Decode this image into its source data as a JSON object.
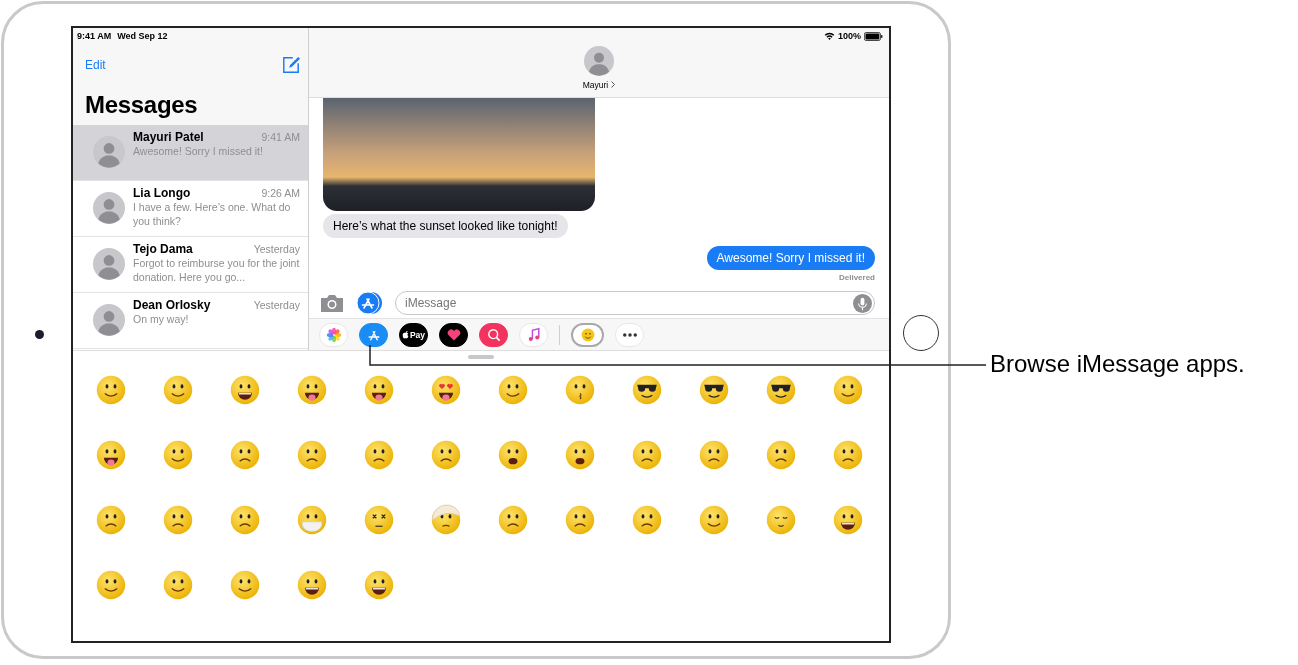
{
  "status_bar": {
    "time": "9:41 AM",
    "date": "Wed Sep 12",
    "battery": "100%"
  },
  "sidebar": {
    "edit": "Edit",
    "title": "Messages",
    "conversations": [
      {
        "name": "Mayuri Patel",
        "time": "9:41 AM",
        "preview": "Awesome! Sorry I missed it!",
        "selected": true
      },
      {
        "name": "Lia Longo",
        "time": "9:26 AM",
        "preview": "I have a few. Here’s one. What do you think?",
        "selected": false
      },
      {
        "name": "Tejo Dama",
        "time": "Yesterday",
        "preview": "Forgot to reimburse you for the joint donation. Here you go...",
        "selected": false
      },
      {
        "name": "Dean Orlosky",
        "time": "Yesterday",
        "preview": "On my way!",
        "selected": false
      }
    ]
  },
  "conversation": {
    "contact": "Mayuri",
    "messages": [
      {
        "kind": "photo",
        "incoming": true
      },
      {
        "kind": "text",
        "incoming": true,
        "text": "Here’s what the sunset looked like tonight!"
      },
      {
        "kind": "text",
        "incoming": false,
        "text": "Awesome! Sorry I missed it!"
      }
    ],
    "receipt": "Delivered",
    "input": {
      "placeholder": "iMessage"
    },
    "apps": [
      {
        "kind": "photos",
        "selected": false
      },
      {
        "kind": "store",
        "selected": false
      },
      {
        "kind": "pay",
        "label": "Pay",
        "selected": false
      },
      {
        "kind": "touch",
        "selected": false
      },
      {
        "kind": "images",
        "selected": false
      },
      {
        "kind": "music",
        "selected": false
      },
      {
        "kind": "stickers",
        "selected": true
      },
      {
        "kind": "more",
        "selected": false
      }
    ]
  },
  "stickers": [
    {
      "kind": "smile"
    },
    {
      "kind": "smile"
    },
    {
      "kind": "grin"
    },
    {
      "kind": "tongue"
    },
    {
      "kind": "tongue"
    },
    {
      "kind": "hearts"
    },
    {
      "kind": "smile"
    },
    {
      "kind": "kiss"
    },
    {
      "kind": "cool"
    },
    {
      "kind": "cool"
    },
    {
      "kind": "cool"
    },
    {
      "kind": "smile"
    },
    {
      "kind": "tongue"
    },
    {
      "kind": "smile"
    },
    {
      "kind": "sad"
    },
    {
      "kind": "sad"
    },
    {
      "kind": "sad"
    },
    {
      "kind": "sad"
    },
    {
      "kind": "open"
    },
    {
      "kind": "open"
    },
    {
      "kind": "sad"
    },
    {
      "kind": "sad"
    },
    {
      "kind": "sad"
    },
    {
      "kind": "sad"
    },
    {
      "kind": "sad"
    },
    {
      "kind": "sad"
    },
    {
      "kind": "sad"
    },
    {
      "kind": "mask"
    },
    {
      "kind": "dizzy"
    },
    {
      "kind": "bandage"
    },
    {
      "kind": "sad"
    },
    {
      "kind": "sad"
    },
    {
      "kind": "sad"
    },
    {
      "kind": "smile"
    },
    {
      "kind": "sleepy"
    },
    {
      "kind": "grin"
    },
    {
      "kind": "smile"
    },
    {
      "kind": "smile"
    },
    {
      "kind": "smile"
    },
    {
      "kind": "grin"
    },
    {
      "kind": "grin"
    }
  ],
  "callout": "Browse iMessage apps."
}
